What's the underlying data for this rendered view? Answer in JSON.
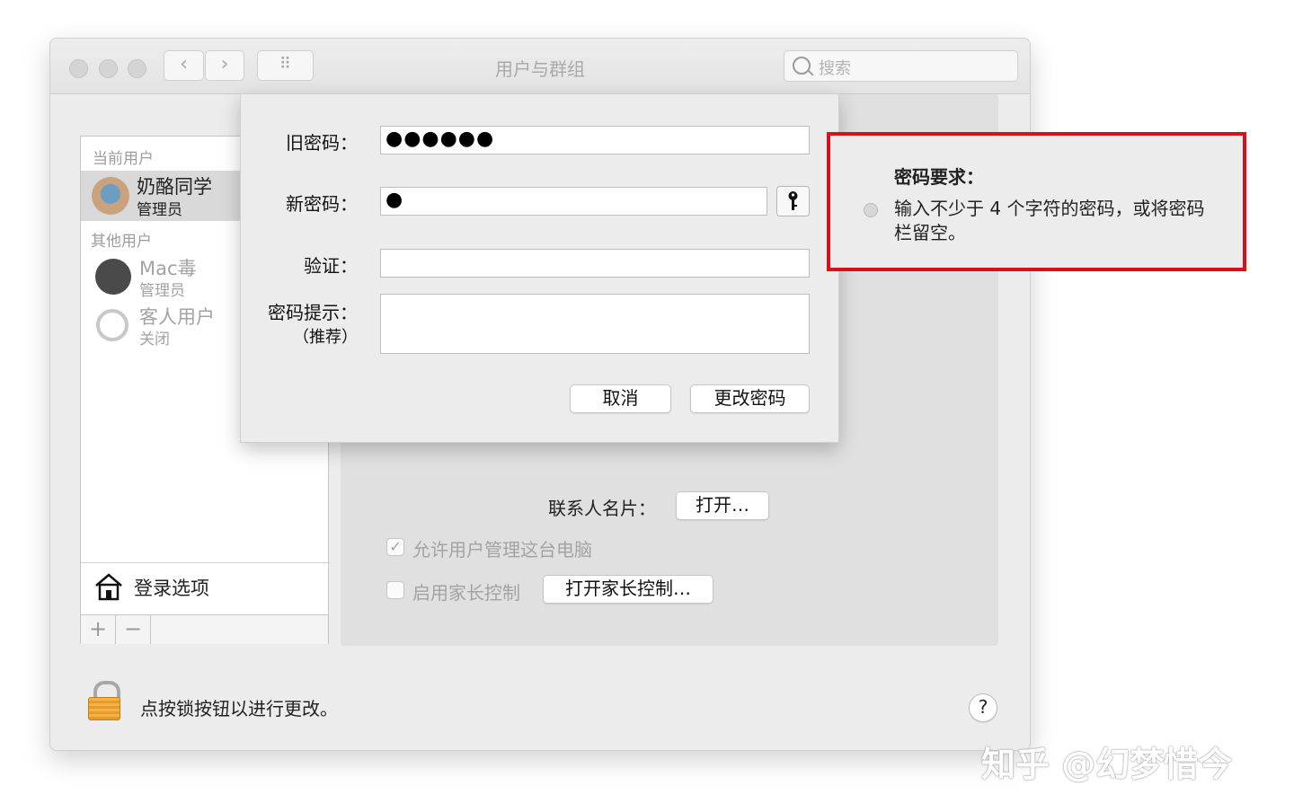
{
  "window": {
    "title": "用户与群组",
    "search_placeholder": "搜索",
    "nav_back": "‹",
    "nav_forward": "›",
    "grid_glyph": "⠿"
  },
  "sidebar": {
    "current_section": "当前用户",
    "current_user": {
      "name": "奶酪同学",
      "role": "管理员"
    },
    "other_section": "其他用户",
    "other_users": [
      {
        "name": "Mac毒",
        "role": "管理员"
      },
      {
        "name": "客人用户",
        "role": "关闭"
      }
    ],
    "login_options": "登录选项",
    "add_label": "+",
    "remove_label": "−"
  },
  "panel": {
    "contact_card_label": "联系人名片：",
    "open_button": "打开…",
    "allow_admin_label": "允许用户管理这台电脑",
    "allow_admin_checked": true,
    "parental_label": "启用家长控制",
    "parental_checked": false,
    "parental_button": "打开家长控制…"
  },
  "dialog": {
    "old_password_label": "旧密码：",
    "old_password_value": "●●●●●●",
    "new_password_label": "新密码：",
    "new_password_value": "●",
    "verify_label": "验证：",
    "verify_value": "",
    "hint_label": "密码提示：",
    "hint_sub": "（推荐）",
    "hint_value": "",
    "cancel_button": "取消",
    "change_button": "更改密码"
  },
  "popover": {
    "title": "密码要求：",
    "requirement": "输入不少于 4 个字符的密码，或将密码栏留空。"
  },
  "footer": {
    "lock_text": "点按锁按钮以进行更改。",
    "help": "?"
  },
  "watermark": "知乎 @幻梦惜今",
  "colors": {
    "highlight_border": "#d7101c",
    "lock": "#f4b24a"
  }
}
